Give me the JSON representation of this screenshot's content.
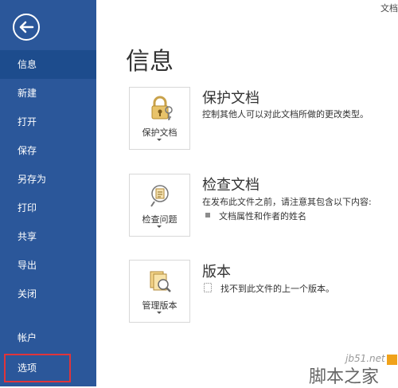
{
  "window": {
    "title": "文档"
  },
  "sidebar": {
    "items": [
      {
        "label": "信息"
      },
      {
        "label": "新建"
      },
      {
        "label": "打开"
      },
      {
        "label": "保存"
      },
      {
        "label": "另存为"
      },
      {
        "label": "打印"
      },
      {
        "label": "共享"
      },
      {
        "label": "导出"
      },
      {
        "label": "关闭"
      },
      {
        "label": "帐户"
      },
      {
        "label": "选项"
      }
    ]
  },
  "main": {
    "title": "信息",
    "sections": [
      {
        "card_label": "保护文档",
        "title": "保护文档",
        "description": "控制其他人可以对此文档所做的更改类型。",
        "icon": "lock-key-icon"
      },
      {
        "card_label": "检查问题",
        "title": "检查文档",
        "description": "在发布此文件之前，请注意其包含以下内容:",
        "bullets": [
          "文档属性和作者的姓名"
        ],
        "icon": "inspect-icon"
      },
      {
        "card_label": "管理版本",
        "title": "版本",
        "description": "找不到此文件的上一个版本。",
        "icon": "versions-icon"
      }
    ]
  },
  "watermark": {
    "site": "jb51.net",
    "brand": "脚本之家"
  },
  "colors": {
    "sidebar": "#2b579a",
    "sidebar_active": "#1d4c8d",
    "highlight": "#e0343a"
  }
}
